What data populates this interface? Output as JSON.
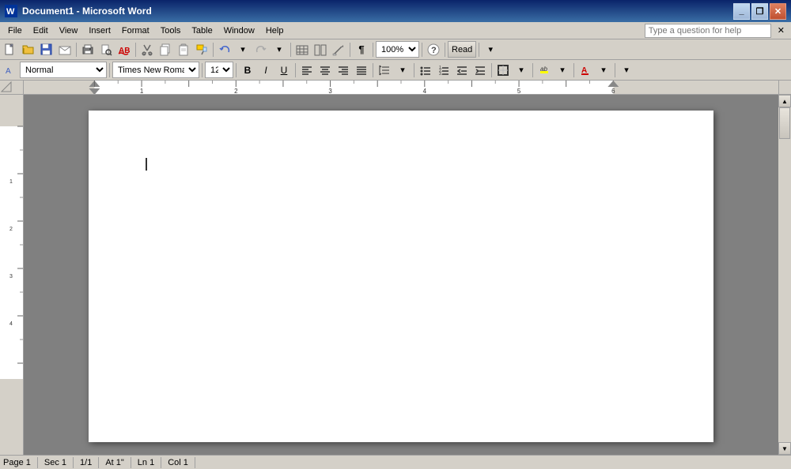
{
  "titleBar": {
    "appIcon": "W",
    "title": "Document1 - Microsoft Word",
    "minimizeLabel": "_",
    "restoreLabel": "❐",
    "closeLabel": "✕"
  },
  "menuBar": {
    "items": [
      "File",
      "Edit",
      "View",
      "Insert",
      "Format",
      "Tools",
      "Table",
      "Window",
      "Help"
    ],
    "helpPlaceholder": "Type a question for help",
    "helpClose": "✕"
  },
  "toolbar1": {
    "buttons": [
      "new",
      "open",
      "save",
      "email",
      "print",
      "preview",
      "spell",
      "cut",
      "copy",
      "paste",
      "format-painter",
      "undo",
      "redo",
      "table",
      "columns",
      "frame",
      "drawing",
      "show-para",
      "zoom",
      "read"
    ]
  },
  "toolbar2": {
    "style": "Normal",
    "font": "Times New Roman",
    "size": "12",
    "boldLabel": "B",
    "italicLabel": "I",
    "underlineLabel": "U",
    "alignLeft": "≡",
    "alignCenter": "≡",
    "alignRight": "≡",
    "alignJustify": "≡"
  },
  "zoom": {
    "value": "100%"
  },
  "readLabel": "Read",
  "statusBar": {
    "page": "Page 1",
    "section": "Sec 1",
    "pageof": "1/1",
    "at": "At 1\"",
    "ln": "Ln 1",
    "col": "Col 1"
  }
}
